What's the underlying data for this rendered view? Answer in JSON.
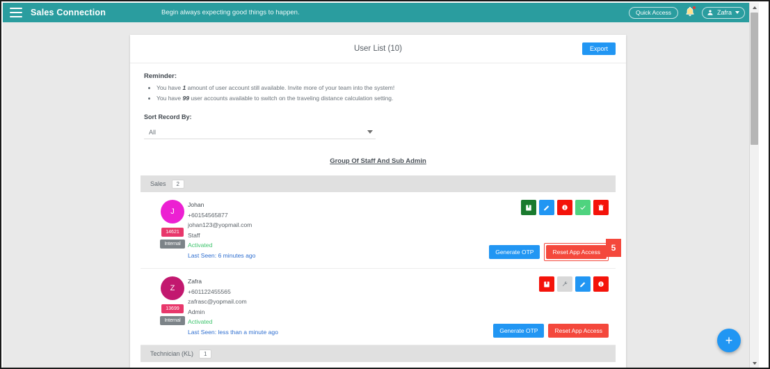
{
  "appbar": {
    "brand": "Sales Connection",
    "tagline": "Begin always expecting good things to happen.",
    "quick_access": "Quick Access",
    "user_name": "Zafra",
    "teal": "#2a9d9f"
  },
  "card": {
    "title": "User List (10)",
    "export_label": "Export",
    "reminder_title": "Reminder:",
    "reminder_items": [
      {
        "pre": "You have ",
        "em": "1",
        "post": " amount of user account still available. Invite more of your team into the system!"
      },
      {
        "pre": "You have ",
        "em": "99",
        "post": " user accounts available to switch on the traveling distance calculation setting."
      }
    ],
    "sort_label": "Sort Record By:",
    "sort_value": "All",
    "group_title": "Group Of Staff And Sub Admin"
  },
  "departments": [
    {
      "name": "Sales",
      "count": "2"
    },
    {
      "name": "Technician (KL)",
      "count": "1"
    }
  ],
  "users": [
    {
      "initial": "J",
      "avatar_color": "#ec20d2",
      "id_badge": "14621",
      "type_badge": "Internal",
      "name": "Johan",
      "phone": "+60154565877",
      "email": "johan123@yopmail.com",
      "role": "Staff",
      "status": "Activated",
      "last_seen": "Last Seen: 6 minutes ago",
      "icons": [
        {
          "name": "book-icon",
          "color": "#1a7a2e"
        },
        {
          "name": "pencil-icon",
          "color": "#2196f3"
        },
        {
          "name": "info-icon",
          "color": "#f4130a"
        },
        {
          "name": "check-icon",
          "color": "#4fd37f"
        },
        {
          "name": "trash-icon",
          "color": "#f4130a"
        }
      ],
      "otp_label": "Generate OTP",
      "reset_label": "Reset App Access",
      "reset_highlighted": true,
      "marker": "5"
    },
    {
      "initial": "Z",
      "avatar_color": "#c2186f",
      "id_badge": "13699",
      "type_badge": "Internal",
      "name": "Zafra",
      "phone": "+601122455565",
      "email": "zafrasc@yopmail.com",
      "role": "Admin",
      "status": "Activated",
      "last_seen": "Last Seen: less than a minute ago",
      "icons": [
        {
          "name": "book-icon",
          "color": "#f4130a"
        },
        {
          "name": "wrench-icon",
          "color": "#d8d8d8"
        },
        {
          "name": "pencil-icon",
          "color": "#2196f3"
        },
        {
          "name": "info-icon",
          "color": "#f4130a"
        }
      ],
      "otp_label": "Generate OTP",
      "reset_label": "Reset App Access",
      "reset_highlighted": false,
      "marker": ""
    }
  ],
  "fab": {
    "label": "+"
  }
}
